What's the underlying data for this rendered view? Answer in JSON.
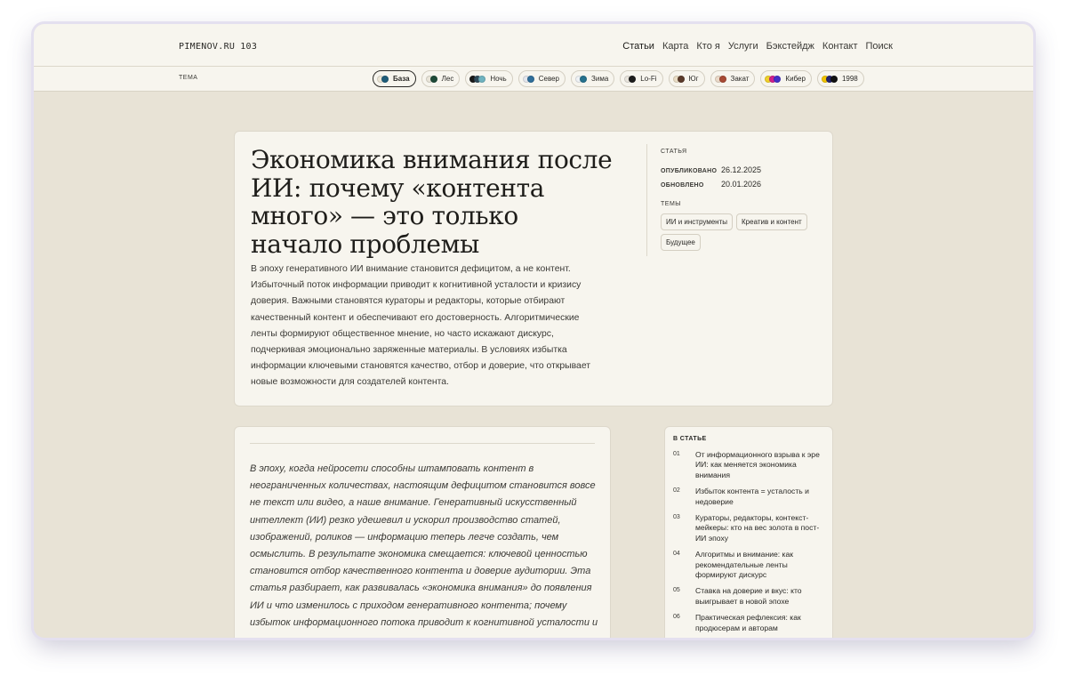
{
  "site": {
    "logo": "PIMENOV.RU",
    "logo_num": "103"
  },
  "nav": [
    "Статьи",
    "Карта",
    "Кто я",
    "Услуги",
    "Бэкстейдж",
    "Контакт",
    "Поиск"
  ],
  "themes": {
    "label": "ТЕМА",
    "items": [
      {
        "label": "База",
        "colors": [
          "#ece6d6",
          "#1f5d7a"
        ],
        "active": true
      },
      {
        "label": "Лес",
        "colors": [
          "#e8e4d8",
          "#1e4a38"
        ]
      },
      {
        "label": "Ночь",
        "colors": [
          "#1a1a1a",
          "#2f4a5a",
          "#6fb3c0"
        ]
      },
      {
        "label": "Север",
        "colors": [
          "#e4e6ec",
          "#2f6e9a"
        ]
      },
      {
        "label": "Зима",
        "colors": [
          "#eef1f4",
          "#26728e"
        ]
      },
      {
        "label": "Lo-Fi",
        "colors": [
          "#e8e4dc",
          "#1c1c1c"
        ]
      },
      {
        "label": "Юг",
        "colors": [
          "#e9dcc4",
          "#5a3a2a"
        ]
      },
      {
        "label": "Закат",
        "colors": [
          "#ead9c8",
          "#a84a34"
        ]
      },
      {
        "label": "Кибер",
        "colors": [
          "#f0d12a",
          "#d0208c",
          "#4230c8"
        ]
      },
      {
        "label": "1998",
        "colors": [
          "#f2c400",
          "#24246e",
          "#111111"
        ]
      }
    ]
  },
  "article": {
    "title": "Экономика внимания после ИИ: почему «контента много» — это только начало проблемы",
    "lead": "В эпоху генеративного ИИ внимание становится дефицитом, а не контент. Избыточный поток информации приводит к когнитивной усталости и кризису доверия. Важными становятся кураторы и редакторы, которые отбирают качественный контент и обеспечивают его достоверность. Алгоритмические ленты формируют общественное мнение, но часто искажают дискурс, подчеркивая эмоционально заряженные материалы. В условиях избытка информации ключевыми становятся качество, отбор и доверие, что открывает новые возможности для создателей контента.",
    "intro": "В эпоху, когда нейросети способны штамповать контент в неограниченных количествах, настоящим дефицитом становится вовсе не текст или видео, а наше внимание. Генеративный искусственный интеллект (ИИ) резко удешевил и ускорил производство статей, изображений, роликов — информацию теперь легче создать, чем осмыслить. В результате экономика смещается: ключевой ценностью становится отбор качественного контента и доверие аудитории. Эта статья разбирает, как развивалась «экономика внимания» до появления ИИ и что изменилось с приходом генеративного контента; почему избыток информационного потока приводит к когнитивной усталости и"
  },
  "meta": {
    "kind": "СТАТЬЯ",
    "published_label": "ОПУБЛИКОВАНО",
    "published": "26.12.2025",
    "updated_label": "ОБНОВЛЕНО",
    "updated": "20.01.2026",
    "topics_label": "ТЕМЫ",
    "tags": [
      "ИИ и инструменты",
      "Креатив и контент",
      "Будущее"
    ]
  },
  "toc": {
    "title": "В СТАТЬЕ",
    "items": [
      {
        "n": "01",
        "text": "От информационного взрыва к эре ИИ: как меняется экономика внимания"
      },
      {
        "n": "02",
        "text": "Избыток контента = усталость и недоверие"
      },
      {
        "n": "03",
        "text": "Кураторы, редакторы, контекст-мейкеры: кто на вес золота в пост-ИИ эпоху"
      },
      {
        "n": "04",
        "text": "Алгоритмы и внимание: как рекомендательные ленты формируют дискурс"
      },
      {
        "n": "05",
        "text": "Ставка на доверие и вкус: кто выигрывает в новой эпохе"
      },
      {
        "n": "06",
        "text": "Практическая рефлексия: как продюсерам и авторам"
      }
    ]
  }
}
